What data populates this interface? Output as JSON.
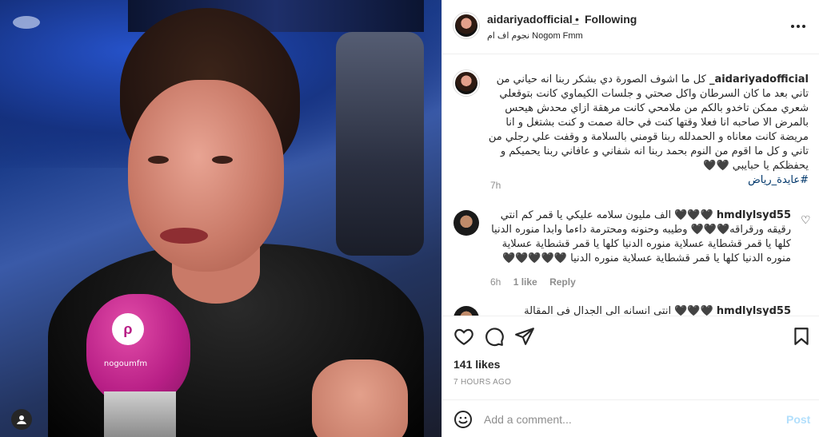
{
  "post": {
    "username": "aidariyadofficial_",
    "follow_status": "Following",
    "separator": "•",
    "location": "نجوم اف ام Nogom Fmm",
    "caption_user": "aidariyadofficial_",
    "caption_text": "كل ما اشوف الصورة دي بشكر ربنا انه حياني من تاني بعد ما كان السرطان واكل صحتي و جلسات الكيماوي كانت بتوقعلي شعري ممكن تاخدو بالكم من ملامحي كانت مرهقة ازاي محدش هيحس بالمرض الا صاحبه انا فعلا وقتها كنت في حالة صمت و كنت بشتغل و انا مريضة كانت معاناه و الحمدلله ربنا قومني بالسلامة و وقفت علي رجلي من تاني و كل ما اقوم من النوم بحمد ربنا انه شفاني و عافاني ربنا يحميكم و يحفظكم يا حبايبي 🖤🖤",
    "caption_hashtag": "#عايدة_رياض",
    "caption_age": "7h",
    "likes": "141 likes",
    "time_ago": "7 HOURS AGO",
    "add_comment_placeholder": "Add a comment...",
    "post_button": "Post"
  },
  "comments": [
    {
      "user": "hmdlylsyd55",
      "text": "🖤🖤🖤 الف مليون سلامه عليكي يا قمر كم انتي رقيقه ورقراقه🖤🖤🖤 وطيبه وحنونه ومحترمة داءما وابدا منوره الدنيا كلها يا قمر قشطاية عسلاية منوره الدنيا كلها يا قمر قشطاية عسلاية منوره الدنيا كلها يا قمر قشطاية عسلاية منوره الدنيا 🖤🖤🖤🖤🖤",
      "age": "6h",
      "likes": "1 like",
      "reply": "Reply"
    },
    {
      "user": "hmdlylsyd55",
      "text": "🖤🖤🖤 انتي انسانه الي الجدال في المقالة والشاكلة الله",
      "age": "",
      "likes": "",
      "reply": ""
    }
  ],
  "photo": {
    "mic_brand": "nogoumfm"
  },
  "colors": {
    "accent_link": "#00376b",
    "post_disabled": "#b2dffc",
    "muted": "#8e8e8e",
    "mic_pink": "#b81f86"
  }
}
